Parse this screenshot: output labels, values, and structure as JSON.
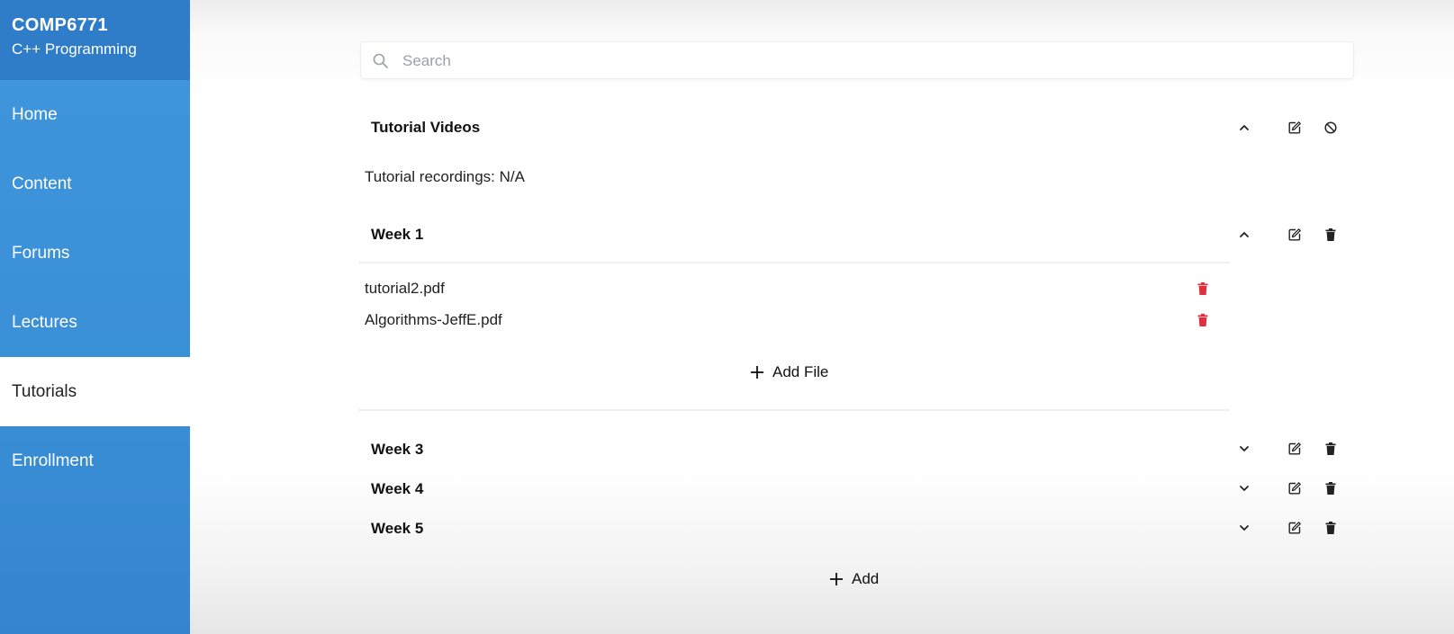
{
  "course": {
    "code": "COMP6771",
    "name": "C++ Programming"
  },
  "nav": [
    {
      "label": "Home"
    },
    {
      "label": "Content"
    },
    {
      "label": "Forums"
    },
    {
      "label": "Lectures"
    },
    {
      "label": "Tutorials",
      "active": true
    },
    {
      "label": "Enrollment"
    }
  ],
  "search": {
    "placeholder": "Search",
    "value": ""
  },
  "sections": {
    "tutorial_videos": {
      "title": "Tutorial Videos",
      "description": "Tutorial recordings: N/A",
      "expanded": true
    },
    "week1": {
      "title": "Week 1",
      "expanded": true,
      "files": [
        {
          "name": "tutorial2.pdf"
        },
        {
          "name": "Algorithms-JeffE.pdf"
        }
      ],
      "add_file_label": "Add File"
    },
    "week3": {
      "title": "Week 3",
      "expanded": false
    },
    "week4": {
      "title": "Week 4",
      "expanded": false
    },
    "week5": {
      "title": "Week 5",
      "expanded": false
    }
  },
  "add_label": "Add",
  "colors": {
    "sidebar": "#3a8fd6",
    "sidebar_header": "#2f7cc8",
    "delete_red": "#e0303f",
    "icon_dark": "#222222"
  }
}
